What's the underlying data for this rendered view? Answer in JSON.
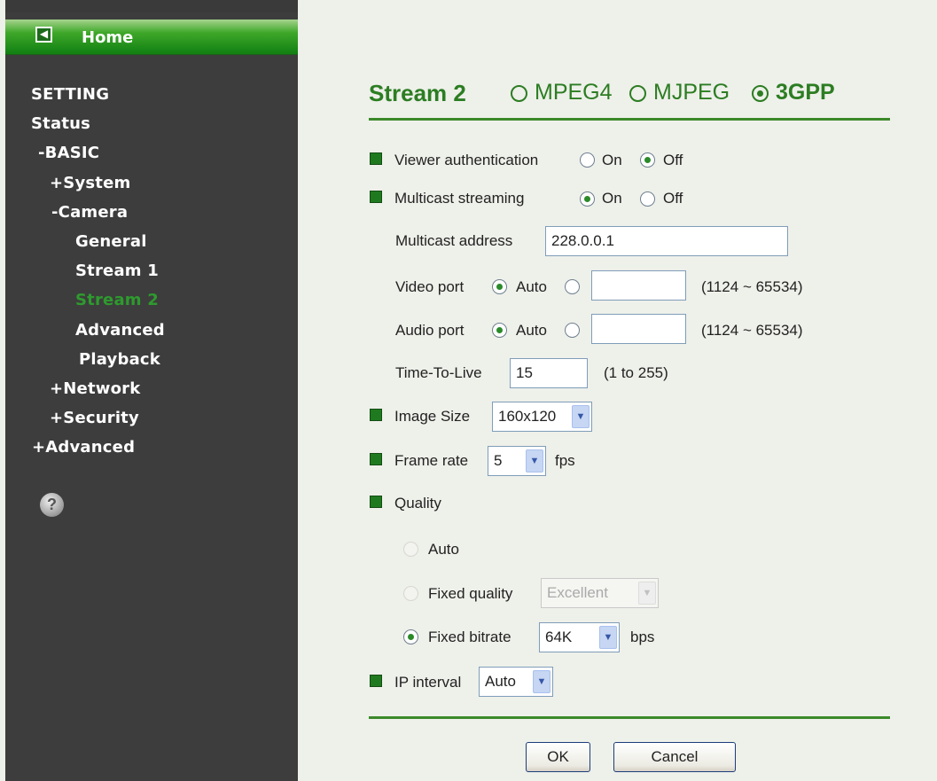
{
  "sidebar": {
    "home": "Home",
    "items": [
      {
        "label": "SETTING"
      },
      {
        "label": "Status"
      },
      {
        "label": "-BASIC"
      },
      {
        "label": "+System"
      },
      {
        "label": "-Camera"
      },
      {
        "label": "General"
      },
      {
        "label": "Stream 1"
      },
      {
        "label": "Stream 2",
        "active": true
      },
      {
        "label": "Advanced"
      },
      {
        "label": "Playback"
      },
      {
        "label": "+Network"
      },
      {
        "label": "+Security"
      },
      {
        "label": "+Advanced"
      }
    ],
    "help_glyph": "?"
  },
  "header": {
    "title": "Stream 2",
    "encodings": [
      {
        "label": "MPEG4",
        "selected": false
      },
      {
        "label": "MJPEG",
        "selected": false
      },
      {
        "label": "3GPP",
        "selected": true
      }
    ]
  },
  "form": {
    "viewer_auth": {
      "label": "Viewer authentication",
      "on": "On",
      "off": "Off",
      "value": "Off"
    },
    "multicast": {
      "label": "Multicast streaming",
      "on": "On",
      "off": "Off",
      "value": "On"
    },
    "multicast_address": {
      "label": "Multicast address",
      "value": "228.0.0.1"
    },
    "video_port": {
      "label": "Video port",
      "auto": "Auto",
      "value": "",
      "range": "(1124 ~ 65534)"
    },
    "audio_port": {
      "label": "Audio port",
      "auto": "Auto",
      "value": "",
      "range": "(1124 ~ 65534)"
    },
    "ttl": {
      "label": "Time-To-Live",
      "value": "15",
      "range": "(1 to 255)"
    },
    "image_size": {
      "label": "Image Size",
      "value": "160x120"
    },
    "frame_rate": {
      "label": "Frame rate",
      "value": "5",
      "unit": "fps"
    },
    "quality": {
      "label": "Quality",
      "auto": "Auto",
      "fixed_quality": "Fixed quality",
      "fixed_quality_value": "Excellent",
      "fixed_bitrate": "Fixed bitrate",
      "fixed_bitrate_value": "64K",
      "bitrate_unit": "bps",
      "selected": "Fixed bitrate"
    },
    "ip_interval": {
      "label": "IP interval",
      "value": "Auto"
    }
  },
  "buttons": {
    "ok": "OK",
    "cancel": "Cancel"
  },
  "colors": {
    "accent_green": "#2c7d22",
    "sidebar_bg": "#3d3d3d",
    "active_nav": "#2e9a2e"
  },
  "icons": {
    "home": "back-arrow-icon",
    "help": "help-icon",
    "dropdown": "chevron-down-icon"
  }
}
